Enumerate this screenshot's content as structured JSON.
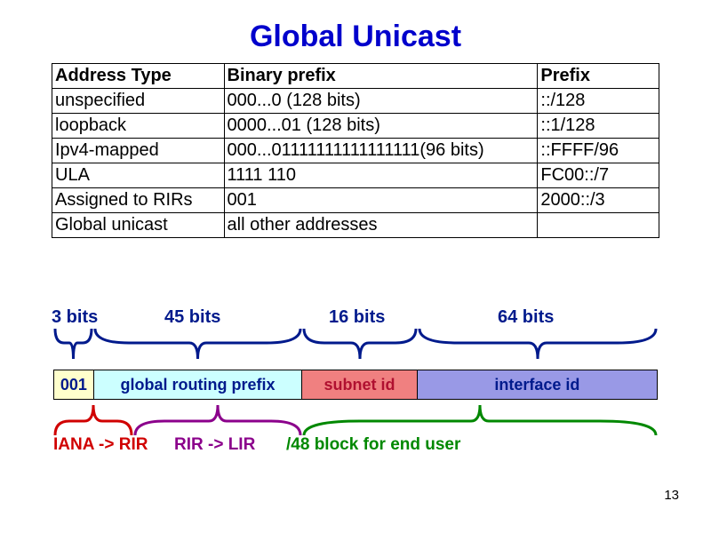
{
  "title": "Global Unicast",
  "table": {
    "headers": [
      "Address Type",
      "Binary prefix",
      "Prefix"
    ],
    "rows": [
      [
        "unspecified",
        "000...0 (128 bits)",
        "::/128"
      ],
      [
        "loopback",
        "0000...01 (128 bits)",
        "::1/128"
      ],
      [
        "Ipv4-mapped",
        "000...01111111111111111(96 bits)",
        "::FFFF/96"
      ],
      [
        "ULA",
        "1111 110",
        "FC00::/7"
      ],
      [
        "Assigned to RIRs",
        "001",
        "2000::/3"
      ],
      [
        "Global unicast",
        "all other addresses",
        ""
      ]
    ]
  },
  "diagram": {
    "bits": {
      "b0": "3 bits",
      "b1": "45 bits",
      "b2": "16 bits",
      "b3": "64 bits"
    },
    "segments": {
      "s0": "001",
      "s1": "global routing prefix",
      "s2": "subnet id",
      "s3": "interface id"
    },
    "bottom": {
      "l0": "IANA -> RIR",
      "l1": "RIR -> LIR",
      "l2": "/48 block for end user"
    }
  },
  "page": "13"
}
